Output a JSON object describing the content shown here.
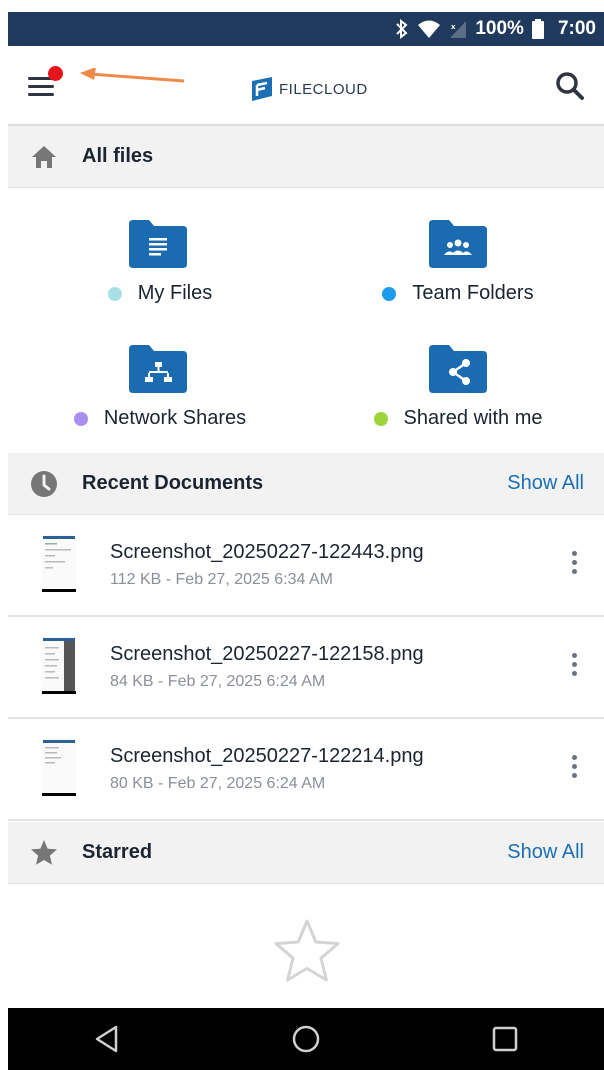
{
  "status_bar": {
    "battery": "100%",
    "time": "7:00",
    "icons": [
      "bluetooth-icon",
      "wifi-icon",
      "signal-icon",
      "battery-icon"
    ]
  },
  "app_bar": {
    "logo_text": "FILECLOUD",
    "icons": [
      "menu-icon",
      "search-icon"
    ],
    "notification_dot_color": "#e8141b",
    "annotation_arrow_color": "#f08a4b"
  },
  "all_files": {
    "title": "All files",
    "icon": "home-icon",
    "folders": [
      {
        "label": "My Files",
        "icon": "folder-document-icon",
        "dot_color": "#a8dfe6"
      },
      {
        "label": "Team Folders",
        "icon": "folder-team-icon",
        "dot_color": "#1e9bef"
      },
      {
        "label": "Network Shares",
        "icon": "folder-network-icon",
        "dot_color": "#a98ff0"
      },
      {
        "label": "Shared with me",
        "icon": "folder-share-icon",
        "dot_color": "#9dd43a"
      }
    ]
  },
  "recent": {
    "title": "Recent Documents",
    "icon": "clock-icon",
    "show_all": "Show All",
    "items": [
      {
        "name": "Screenshot_20250227-122443.png",
        "meta": "112 KB - Feb 27, 2025 6:34 AM"
      },
      {
        "name": "Screenshot_20250227-122158.png",
        "meta": "84 KB - Feb 27, 2025 6:24 AM"
      },
      {
        "name": "Screenshot_20250227-122214.png",
        "meta": "80 KB - Feb 27, 2025 6:24 AM"
      }
    ]
  },
  "starred": {
    "title": "Starred",
    "icon": "star-icon",
    "show_all": "Show All",
    "empty_icon": "star-outline-icon"
  },
  "nav_bar": {
    "icons": [
      "back-icon",
      "home-circle-icon",
      "recents-square-icon"
    ]
  },
  "colors": {
    "accent": "#1c6fb5",
    "folder_blue": "#1a6bb0",
    "status_bar_bg": "#1f3a5c"
  }
}
